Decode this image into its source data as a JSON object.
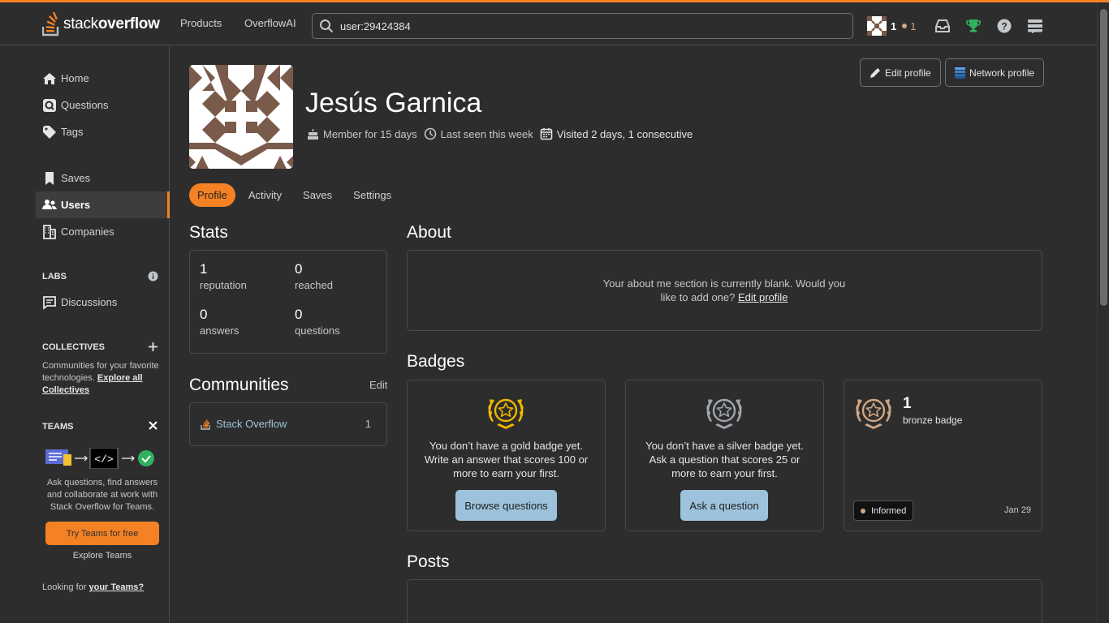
{
  "header": {
    "logo_text_light": "stack",
    "logo_text_bold": "overflow",
    "nav_products": "Products",
    "nav_overflowai": "OverflowAI",
    "search_value": "user:29424384",
    "reputation": "1",
    "bronze_count": "1"
  },
  "sidebar": {
    "items": [
      {
        "label": "Home",
        "icon": "home-icon"
      },
      {
        "label": "Questions",
        "icon": "questions-icon"
      },
      {
        "label": "Tags",
        "icon": "tag-icon"
      },
      {
        "label": "Saves",
        "icon": "bookmark-icon"
      },
      {
        "label": "Users",
        "icon": "users-icon"
      },
      {
        "label": "Companies",
        "icon": "building-icon"
      },
      {
        "label": "Discussions",
        "icon": "discussions-icon"
      }
    ],
    "labs_title": "LABS",
    "collectives_title": "COLLECTIVES",
    "collectives_text": "Communities for your favorite technologies.",
    "collectives_link": "Explore all Collectives",
    "teams_title": "TEAMS",
    "teams_text": "Ask questions, find answers and collaborate at work with Stack Overflow for Teams.",
    "teams_button": "Try Teams for free",
    "explore_teams": "Explore Teams",
    "looking_for": "Looking for",
    "your_teams": "your Teams?"
  },
  "profile": {
    "name": "Jesús Garnica",
    "member_for": "Member for 15 days",
    "last_seen": "Last seen this week",
    "visited": "Visited 2 days, 1 consecutive",
    "edit_profile": "Edit profile",
    "network_profile": "Network profile"
  },
  "tabs": [
    "Profile",
    "Activity",
    "Saves",
    "Settings"
  ],
  "stats": {
    "title": "Stats",
    "reputation": {
      "value": "1",
      "label": "reputation"
    },
    "reached": {
      "value": "0",
      "label": "reached"
    },
    "answers": {
      "value": "0",
      "label": "answers"
    },
    "questions": {
      "value": "0",
      "label": "questions"
    }
  },
  "communities": {
    "title": "Communities",
    "edit": "Edit",
    "items": [
      {
        "name": "Stack Overflow",
        "count": "1"
      }
    ]
  },
  "about": {
    "title": "About",
    "text": "Your about me section is currently blank. Would you like to add one?",
    "link": "Edit profile"
  },
  "badges": {
    "title": "Badges",
    "gold_text": "You don’t have a gold badge yet. Write an answer that scores 100 or more to earn your first.",
    "gold_button": "Browse questions",
    "silver_text": "You don’t have a silver badge yet. Ask a question that scores 25 or more to earn your first.",
    "silver_button": "Ask a question",
    "bronze_count": "1",
    "bronze_label": "bronze badge",
    "bronze_badge_name": "Informed",
    "bronze_badge_date": "Jan 29"
  },
  "posts": {
    "title": "Posts"
  },
  "colors": {
    "accent": "#f48225",
    "link": "#9cc3db",
    "gold": "#f1b600",
    "silver": "#9fa6ad",
    "bronze": "#d1a684"
  }
}
